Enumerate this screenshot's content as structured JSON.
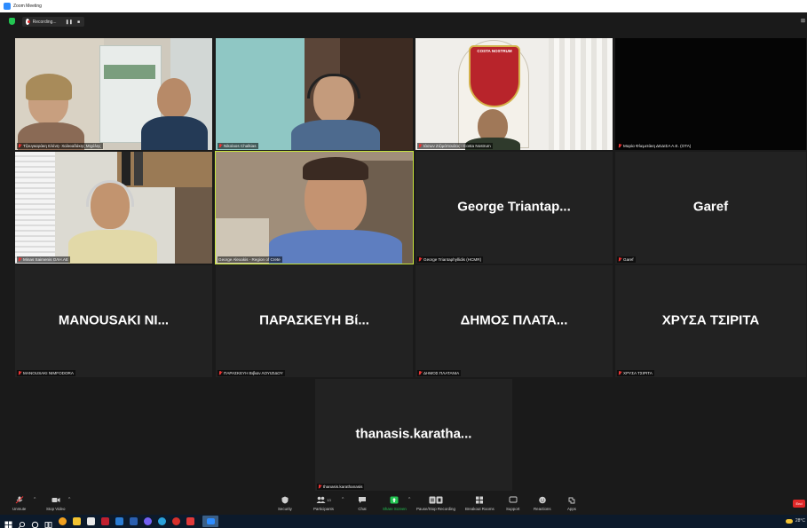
{
  "window": {
    "title": "Zoom Meeting"
  },
  "recording": {
    "status": "Recording...",
    "pause": "❚❚",
    "stop": "■"
  },
  "view_button": "⊞",
  "tiles": [
    {
      "id": "t1",
      "label": "Τζουγκαράκη Ελένη- Χαλκιαδάκης Μιχάλης",
      "video": true
    },
    {
      "id": "t2",
      "label": "Nikolaos Chalkias",
      "video": true
    },
    {
      "id": "t3",
      "label": "Costa Nostrum",
      "label_prefix": "Ιάσων Ζιζιμόπουλος -",
      "video": true,
      "logo_text": "COSTA NOSTRUM"
    },
    {
      "id": "t4",
      "label": "Μαρία Φλεμετάκη ΔΕΔΙΣΑ Α.Ε. (ΟΤΑ)",
      "video": true
    },
    {
      "id": "t5",
      "label": "Minas Saimenis ΟΛΗ.ΑΕ",
      "video": true
    },
    {
      "id": "t6",
      "label": "George Alexakis - Region of Crete",
      "video": true
    },
    {
      "id": "t7",
      "big": "George  Triantap...",
      "label": "George Triantaphyllidis (HCMR)"
    },
    {
      "id": "t8",
      "big": "Garef",
      "label": "Garef"
    },
    {
      "id": "t9",
      "big": "MANOUSAKI  NI...",
      "label": "MANOUSAKI NIMFODORA"
    },
    {
      "id": "t10",
      "big": "ΠΑΡΑΣΚΕΥΗ  Βί...",
      "label": "ΠΑΡΑΣΚΕΥΗ Βιβιαν ΛΟΥΙΖΙΔΟΥ"
    },
    {
      "id": "t11",
      "big": "ΔΗΜΟΣ  ΠΛΑΤΑ...",
      "label": "ΔΗΜΟΣ ΠΛΑΤΑΝΙΑ"
    },
    {
      "id": "t12",
      "big": "ΧΡΥΣΑ  ΤΣΙΡΙΤΑ",
      "label": "ΧΡΥΣΑ ΤΣΙΡΙΤΑ"
    },
    {
      "id": "t13",
      "big": "thanasis.karatha...",
      "label": "thanasis.karathanasis"
    }
  ],
  "toolbar": {
    "unmute": "Unmute",
    "stop_video": "Stop Video",
    "security": "Security",
    "participants": "Participants",
    "participants_count": "13",
    "chat": "Chat",
    "share_screen": "Share Screen",
    "recording": "Pause/Stop Recording",
    "breakout": "Breakout Rooms",
    "support": "Support",
    "reactions": "Reactions",
    "apps": "Apps",
    "end": "End"
  },
  "taskbar": {
    "temperature": "28°C"
  },
  "colors": {
    "active_speaker": "#c8e63c",
    "share_green": "#23c552",
    "end_red": "#e02828"
  }
}
